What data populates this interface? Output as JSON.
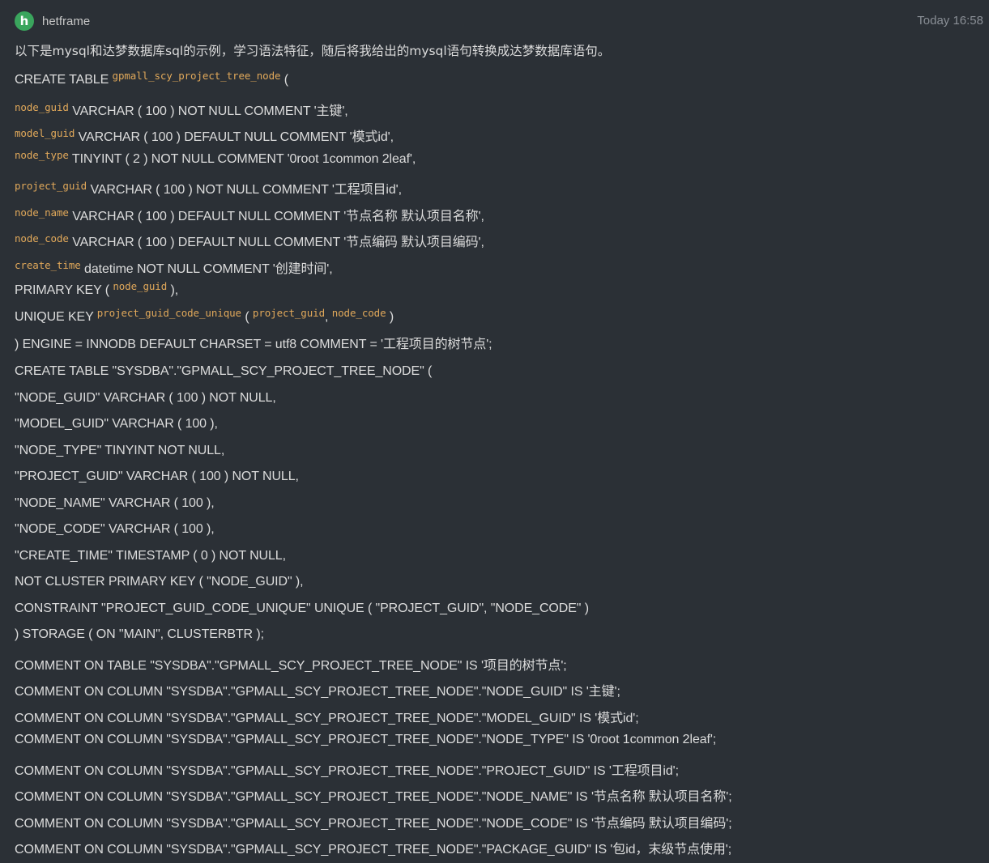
{
  "header": {
    "avatar_letter": "h",
    "username": "hetframe",
    "timestamp": "Today 16:58"
  },
  "intro": "以下是mysql和达梦数据库sql的示例，学习语法特征，随后将我给出的mysql语句转换成达梦数据库语句。",
  "mysql": {
    "l1_a": "CREATE TABLE ",
    "l1_code": "gpmall_scy_project_tree_node",
    "l1_b": " (",
    "l2_code": "node_guid",
    "l2_b": " VARCHAR ( 100 ) NOT NULL COMMENT '主键',",
    "l3_code": "model_guid",
    "l3_b": " VARCHAR ( 100 ) DEFAULT NULL COMMENT '模式id',",
    "l4_code": "node_type",
    "l4_b": " TINYINT ( 2 ) NOT NULL COMMENT '0root 1common 2leaf',",
    "l5_code": "project_guid",
    "l5_b": " VARCHAR ( 100 ) NOT NULL COMMENT '工程项目id',",
    "l6_code": "node_name",
    "l6_b": " VARCHAR ( 100 ) DEFAULT NULL COMMENT '节点名称 默认项目名称',",
    "l7_code": "node_code",
    "l7_b": " VARCHAR ( 100 ) DEFAULT NULL COMMENT '节点编码 默认项目编码',",
    "l8_code": "create_time",
    "l8_b": " datetime NOT NULL COMMENT '创建时间',",
    "l9_a": "PRIMARY KEY ( ",
    "l9_code": "node_guid",
    "l9_b": " ),",
    "l10_a": "UNIQUE KEY ",
    "l10_code1": "project_guid_code_unique",
    "l10_b": " ( ",
    "l10_code2": "project_guid",
    "l10_c": ", ",
    "l10_code3": "node_code",
    "l10_d": " )",
    "l11": ") ENGINE = INNODB DEFAULT CHARSET = utf8 COMMENT = '工程项目的树节点';"
  },
  "dm": [
    "CREATE TABLE \"SYSDBA\".\"GPMALL_SCY_PROJECT_TREE_NODE\" (",
    "\"NODE_GUID\" VARCHAR ( 100 ) NOT NULL,",
    "\"MODEL_GUID\" VARCHAR ( 100 ),",
    "\"NODE_TYPE\" TINYINT NOT NULL,",
    "\"PROJECT_GUID\" VARCHAR ( 100 ) NOT NULL,",
    "\"NODE_NAME\" VARCHAR ( 100 ),",
    "\"NODE_CODE\" VARCHAR ( 100 ),",
    "\"CREATE_TIME\" TIMESTAMP ( 0 ) NOT NULL,",
    "NOT CLUSTER PRIMARY KEY ( \"NODE_GUID\" ),",
    "CONSTRAINT \"PROJECT_GUID_CODE_UNIQUE\" UNIQUE ( \"PROJECT_GUID\", \"NODE_CODE\" )",
    ") STORAGE ( ON \"MAIN\", CLUSTERBTR );",
    "COMMENT ON TABLE \"SYSDBA\".\"GPMALL_SCY_PROJECT_TREE_NODE\" IS '项目的树节点';",
    "COMMENT ON COLUMN \"SYSDBA\".\"GPMALL_SCY_PROJECT_TREE_NODE\".\"NODE_GUID\" IS '主键';",
    "COMMENT ON COLUMN \"SYSDBA\".\"GPMALL_SCY_PROJECT_TREE_NODE\".\"MODEL_GUID\" IS '模式id';",
    "COMMENT ON COLUMN \"SYSDBA\".\"GPMALL_SCY_PROJECT_TREE_NODE\".\"NODE_TYPE\" IS '0root 1common 2leaf';",
    "COMMENT ON COLUMN \"SYSDBA\".\"GPMALL_SCY_PROJECT_TREE_NODE\".\"PROJECT_GUID\" IS '工程项目id';",
    "COMMENT ON COLUMN \"SYSDBA\".\"GPMALL_SCY_PROJECT_TREE_NODE\".\"NODE_NAME\" IS '节点名称 默认项目名称';",
    "COMMENT ON COLUMN \"SYSDBA\".\"GPMALL_SCY_PROJECT_TREE_NODE\".\"NODE_CODE\" IS '节点编码 默认项目编码';",
    "COMMENT ON COLUMN \"SYSDBA\".\"GPMALL_SCY_PROJECT_TREE_NODE\".\"PACKAGE_GUID\" IS '包id，末级节点使用';"
  ],
  "colors": {
    "background": "#2b3036",
    "text": "#dcdcdc",
    "inline_code": "#e0a85a",
    "avatar": "#3aa55d",
    "timestamp": "#8a8f96"
  }
}
